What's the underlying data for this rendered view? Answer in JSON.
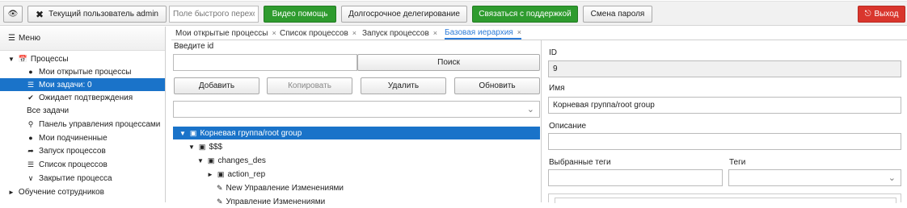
{
  "topbar": {
    "eye_label": "",
    "user_label": "Текущий пользователь admin",
    "quick_search_placeholder": "Поле быстрого перехо",
    "video_help": "Видео помощь",
    "long_delegation": "Долгосрочное делегирование",
    "contact_support": "Связаться с поддержкой",
    "change_password": "Смена пароля",
    "exit": "Выход"
  },
  "sidebar": {
    "menu_title": "Меню",
    "items": [
      {
        "label": "Процессы",
        "icon": "calendar-icon"
      },
      {
        "label": "Мои открытые процессы",
        "icon": "user-icon"
      },
      {
        "label": "Мои задачи: 0",
        "icon": "list-icon"
      },
      {
        "label": "Ожидает подтверждения",
        "icon": "check-circle-icon"
      },
      {
        "label": "Все задачи",
        "icon": ""
      },
      {
        "label": "Панель управления процессами",
        "icon": "pin-icon"
      },
      {
        "label": "Мои подчиненные",
        "icon": "user-icon"
      },
      {
        "label": "Запуск процессов",
        "icon": "share-icon"
      },
      {
        "label": "Список процессов",
        "icon": "stack-icon"
      },
      {
        "label": "Закрытие процесса",
        "icon": "chevron-down-icon"
      },
      {
        "label": "Обучение сотрудников",
        "icon": "caret-right-icon"
      }
    ]
  },
  "tabs": [
    {
      "label": "Мои открытые процессы"
    },
    {
      "label": "Список процессов"
    },
    {
      "label": "Запуск процессов"
    },
    {
      "label": "Базовая иерархия"
    }
  ],
  "left_panel": {
    "enter_id_label": "Введите id",
    "id_value": "",
    "search_button": "Поиск",
    "add_button": "Добавить",
    "copy_button": "Копировать",
    "delete_button": "Удалить",
    "refresh_button": "Обновить",
    "select_value": "",
    "tree": [
      {
        "label": "Корневая группа/root group"
      },
      {
        "label": "$$$"
      },
      {
        "label": "changes_des"
      },
      {
        "label": "action_rep"
      },
      {
        "label": "New Управление Изменениями"
      },
      {
        "label": "Управление Изменениями"
      }
    ]
  },
  "right_panel": {
    "id_label": "ID",
    "id_value": "9",
    "name_label": "Имя",
    "name_value": "Корневая группа/root group",
    "description_label": "Описание",
    "description_value": "",
    "selected_tags_label": "Выбранные теги",
    "selected_tags_value": "",
    "tags_label": "Теги",
    "tags_value": ""
  },
  "colors": {
    "accent": "#1a73c9",
    "green": "#2e9b2e",
    "red": "#d9362d"
  }
}
